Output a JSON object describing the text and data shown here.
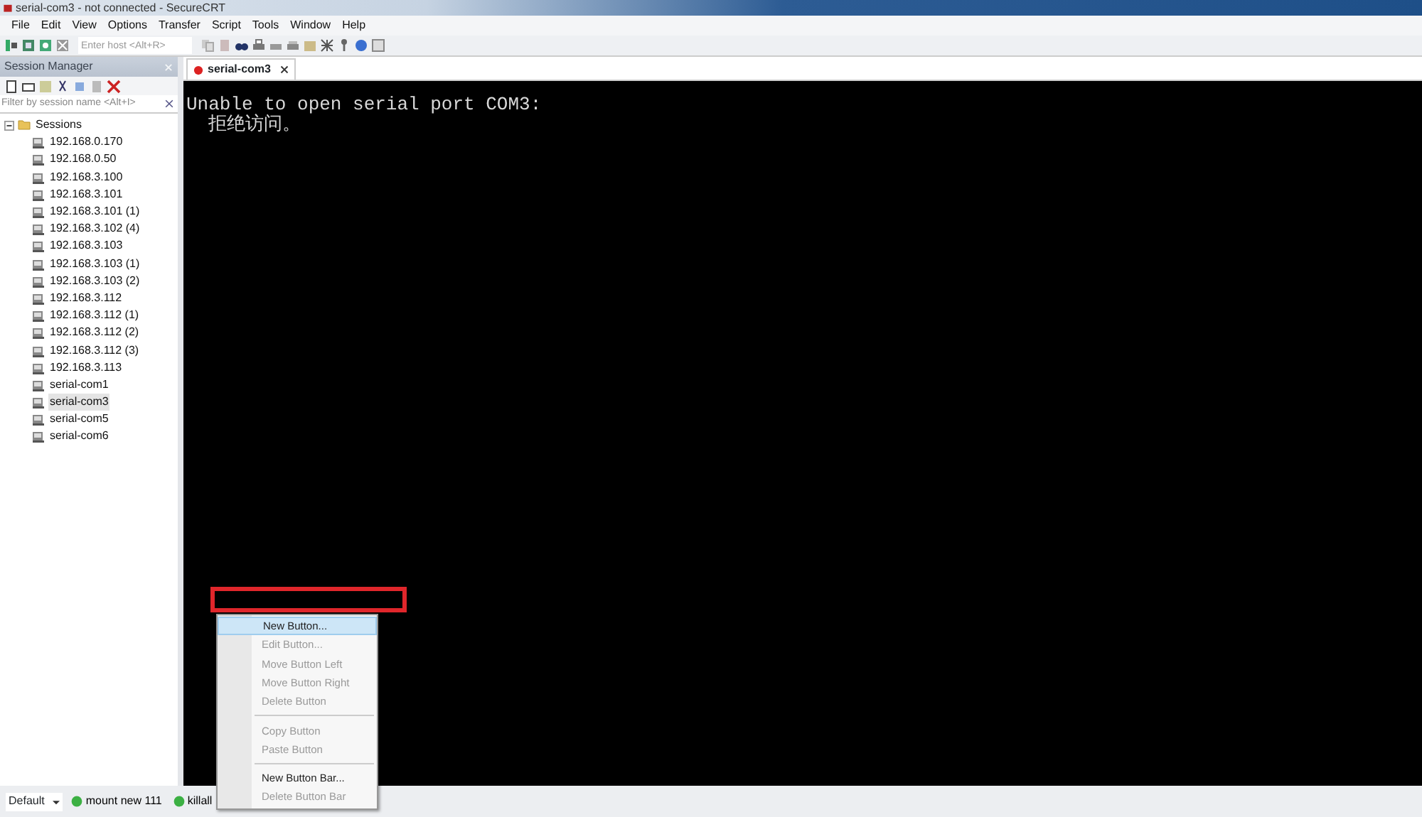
{
  "window": {
    "title": "serial-com3 - not connected - SecureCRT"
  },
  "menu_bar": [
    "File",
    "Edit",
    "View",
    "Options",
    "Transfer",
    "Script",
    "Tools",
    "Window",
    "Help"
  ],
  "toolbar": {
    "host_field": {
      "placeholder": "Enter host <Alt+R>"
    }
  },
  "session_manager": {
    "title": "Session Manager",
    "filter": {
      "placeholder": "Filter by session name <Alt+I>"
    },
    "tree": [
      {
        "label": "Sessions",
        "expanded": true,
        "children": [
          {
            "label": "192.168.0.170",
            "selected": false
          },
          {
            "label": "192.168.0.50",
            "selected": false
          },
          {
            "label": "192.168.3.100",
            "selected": false
          },
          {
            "label": "192.168.3.101",
            "selected": false
          },
          {
            "label": "192.168.3.101 (1)",
            "selected": false
          },
          {
            "label": "192.168.3.102 (4)",
            "selected": false
          },
          {
            "label": "192.168.3.103",
            "selected": false
          },
          {
            "label": "192.168.3.103 (1)",
            "selected": false
          },
          {
            "label": "192.168.3.103 (2)",
            "selected": false
          },
          {
            "label": "192.168.3.112",
            "selected": false
          },
          {
            "label": "192.168.3.112 (1)",
            "selected": false
          },
          {
            "label": "192.168.3.112 (2)",
            "selected": false
          },
          {
            "label": "192.168.3.112 (3)",
            "selected": false
          },
          {
            "label": "192.168.3.113",
            "selected": false
          },
          {
            "label": "serial-com1",
            "selected": false
          },
          {
            "label": "serial-com3",
            "selected": true
          },
          {
            "label": "serial-com5",
            "selected": false
          },
          {
            "label": "serial-com6",
            "selected": false
          }
        ]
      }
    ]
  },
  "tabs": [
    {
      "label": "serial-com3",
      "selected": true
    }
  ],
  "terminal": {
    "lines": [
      "Unable to open serial port COM3:",
      "  拒绝访问。"
    ]
  },
  "context_menu": [
    {
      "kind": "item",
      "label": "New Button...",
      "disabled": false,
      "selected": true
    },
    {
      "kind": "item",
      "label": "Edit Button...",
      "disabled": true,
      "selected": false
    },
    {
      "kind": "item",
      "label": "Move Button Left",
      "disabled": true,
      "selected": false
    },
    {
      "kind": "item",
      "label": "Move Button Right",
      "disabled": true,
      "selected": false
    },
    {
      "kind": "item",
      "label": "Delete Button",
      "disabled": true,
      "selected": false
    },
    {
      "kind": "separator"
    },
    {
      "kind": "item",
      "label": "Copy Button",
      "disabled": true,
      "selected": false
    },
    {
      "kind": "item",
      "label": "Paste Button",
      "disabled": true,
      "selected": false
    },
    {
      "kind": "separator"
    },
    {
      "kind": "item",
      "label": "New Button Bar...",
      "disabled": false,
      "selected": false
    },
    {
      "kind": "item",
      "label": "Delete Button Bar",
      "disabled": true,
      "selected": false
    }
  ],
  "button_bar": {
    "selector": "Default",
    "buttons": [
      "mount new 111",
      "killall"
    ]
  }
}
